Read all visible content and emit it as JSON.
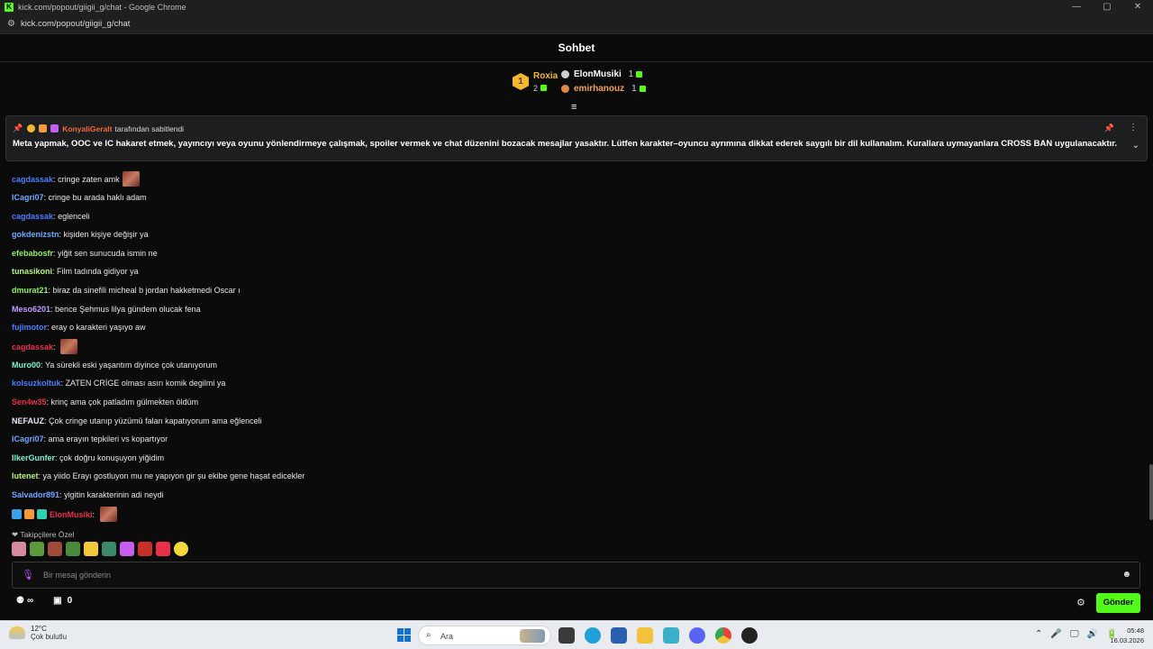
{
  "window": {
    "title": "kick.com/popout/giigii_g/chat - Google Chrome",
    "logo_letter": "K",
    "min": "—",
    "max": "▢",
    "close": "✕"
  },
  "address": {
    "url": "kick.com/popout/giigii_g/chat",
    "tune_icon": "⚙"
  },
  "header": {
    "title": "Sohbet"
  },
  "leaderboard": {
    "first": {
      "rank": "1",
      "name": "Roxia",
      "count": "2"
    },
    "others": [
      {
        "name": "ElonMusiki",
        "count": "1",
        "color": "#ffffff",
        "icon_color": "#cfcfcf"
      },
      {
        "name": "emirhanouz",
        "count": "1",
        "color": "#f5a25c",
        "icon_color": "#e08a45"
      }
    ],
    "collapse_icon": "≡"
  },
  "pinned": {
    "pin_icon": "📌",
    "author": "KonyaliGeralt",
    "suffix": "tarafından sabitlendi",
    "body": "Meta yapmak, OOC ve IC hakaret etmek, yayıncıyı veya oyunu yönlendirmeye çalışmak, spoiler vermek ve chat düzenini bozacak mesajlar yasaktır. Lütfen karakter–oyuncu ayrımına dikkat ederek saygılı bir dil kullanalım. Kurallara uymayanlara CROSS BAN uygulanacaktır.",
    "pin_right": "📌",
    "more": "⋮",
    "chevron": "⌄"
  },
  "messages": [
    {
      "user": "cagdassak",
      "color": "#4a7dff",
      "text": "cringe zaten amk",
      "emote": true
    },
    {
      "user": "ICagri07",
      "color": "#6fa6ff",
      "text": "cringe bu arada haklı adam",
      "emote": false
    },
    {
      "user": "cagdassak",
      "color": "#4a7dff",
      "text": "eglenceli",
      "emote": false
    },
    {
      "user": "gokdenizstn",
      "color": "#6fa6ff",
      "text": "kişiden kişiye değişir ya",
      "emote": false
    },
    {
      "user": "efebabosfr",
      "color": "#8cf25a",
      "text": "yiğit sen sunucuda ismin ne",
      "emote": false
    },
    {
      "user": "tunasikoni",
      "color": "#b9f27a",
      "text": "Film tadında gidiyor ya",
      "emote": false
    },
    {
      "user": "dmurat21",
      "color": "#8cf25a",
      "text": "biraz da sinefili micheal b jordan hakketmedi Oscar ı",
      "emote": false
    },
    {
      "user": "Meso6201",
      "color": "#c49bff",
      "text": "bence Şehmus lilya gündem olucak fena",
      "emote": false
    },
    {
      "user": "fujimotor",
      "color": "#4a7dff",
      "text": "eray o karakteri yaşıyo aw",
      "emote": false
    },
    {
      "user": "cagdassak",
      "color": "#e8304a",
      "text": "",
      "emote": true
    },
    {
      "user": "Muro00",
      "color": "#7df2d0",
      "text": "Ya sürekli eski yaşantım diyince çok utanıyorum",
      "emote": false
    },
    {
      "user": "kolsuzkoltuk",
      "color": "#4a7dff",
      "text": "ZATEN CRİGE olması asırı komik degilmi ya",
      "emote": false
    },
    {
      "user": "Sen4w35",
      "color": "#e8304a",
      "text": "krinç ama çok patladım gülmekten öldüm",
      "emote": false
    },
    {
      "user": "NEFAUZ",
      "color": "#e8e8f8",
      "text": "Çok cringe utanıp yüzümü falan kapatıyorum ama eğlenceli",
      "emote": false
    },
    {
      "user": "ICagri07",
      "color": "#6fa6ff",
      "text": "ama erayın tepkileri vs kopartıyor",
      "emote": false
    },
    {
      "user": "IlkerGunfer",
      "color": "#7df2d0",
      "text": "çok doğru konuşuyon yiğidim",
      "emote": false
    },
    {
      "user": "lutenet",
      "color": "#b9f27a",
      "text": "ya yiido Erayı gostluyon mu ne yapıyon gir şu ekibe gene haşat edicekler",
      "emote": false
    },
    {
      "user": "Salvador891",
      "color": "#6fa6ff",
      "text": "yigitin karakterinin adi neydi",
      "emote": false
    },
    {
      "user": "ElonMusiki",
      "color": "#e8304a",
      "text": "",
      "emote": true
    }
  ],
  "followers": {
    "label": "❤ Takipçilere Özel"
  },
  "input": {
    "placeholder": "Bir mesaj gönderin",
    "mic_icon": "🎙",
    "emoji_icon": "☻"
  },
  "tools": {
    "points_icon": "⚉",
    "points": "∞",
    "gift_icon": "▣",
    "gift_count": "0",
    "gear_icon": "⚙"
  },
  "send_label": "Gönder",
  "taskbar": {
    "temp": "12°C",
    "weather": "Çok bulutlu",
    "search": "Ara",
    "tray": [
      "⌃",
      "🎤",
      "🖵",
      "🔊",
      "🔋"
    ],
    "time": "05:48",
    "date": "16.03.2026"
  }
}
